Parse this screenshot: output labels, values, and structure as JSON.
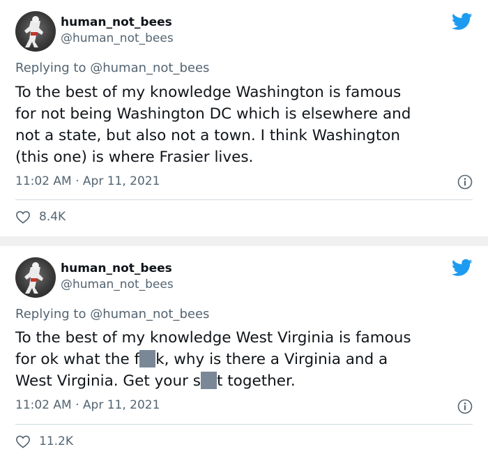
{
  "tweets": [
    {
      "display_name": "human_not_bees",
      "handle": "@human_not_bees",
      "replying_prefix": "Replying to",
      "replying_to": "@human_not_bees",
      "text_lines": [
        "To the best of my knowledge Washington is famous",
        "for not being Washington DC which is elsewhere and",
        "not a state, but also not a town. I think Washington",
        "(this one) is where Frasier lives."
      ],
      "timestamp": "11:02 AM · Apr 11, 2021",
      "likes": "8.4K"
    },
    {
      "display_name": "human_not_bees",
      "handle": "@human_not_bees",
      "replying_prefix": "Replying to",
      "replying_to": "@human_not_bees",
      "text_line_1": "To the best of my knowledge West Virginia is famous",
      "text_line_2_a": "for ok what the f",
      "text_line_2_b": "k, why is there a Virginia and a",
      "text_line_3_a": "West Virginia. Get your s",
      "text_line_3_b": "t together.",
      "timestamp": "11:02 AM · Apr 11, 2021",
      "likes": "11.2K"
    }
  ],
  "icons": {
    "brand": "twitter-bird-icon",
    "info": "info-icon",
    "like": "heart-icon",
    "avatar": "avatar"
  },
  "colors": {
    "twitter_blue": "#1d9bf0",
    "secondary_text": "#536471",
    "censor_block": "#7a8796"
  }
}
